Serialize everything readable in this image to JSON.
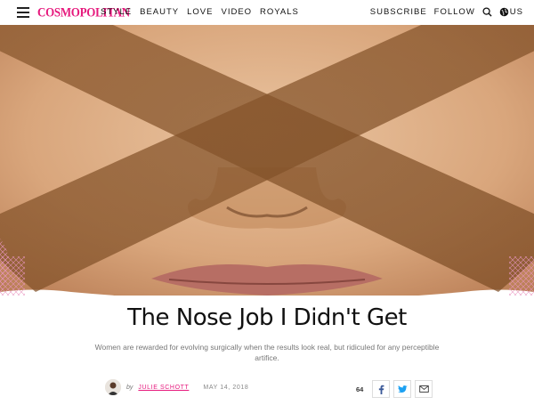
{
  "header": {
    "logo": "Cosmopolitan",
    "nav": [
      "STYLE",
      "BEAUTY",
      "LOVE",
      "VIDEO",
      "ROYALS"
    ],
    "subscribe": "SUBSCRIBE",
    "follow": "FOLLOW",
    "region": "US",
    "brand_color": "#e6197d"
  },
  "article": {
    "title": "The Nose Job I Didn't Get",
    "dek": "Women are rewarded for evolving surgically when the results look real, but ridiculed for any perceptible artifice.",
    "byline_prefix": "by",
    "author": "JULIE SCHOTT",
    "date": "MAY 14, 2018"
  },
  "share": {
    "count": "64",
    "icons": [
      "facebook-icon",
      "twitter-icon",
      "email-icon"
    ]
  }
}
